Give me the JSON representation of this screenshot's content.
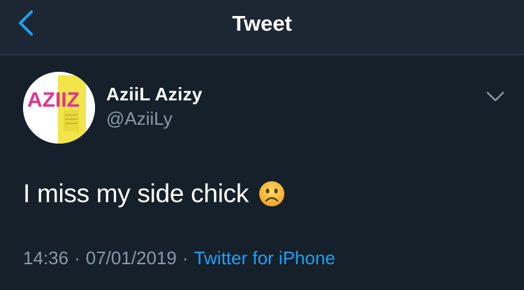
{
  "header": {
    "title": "Tweet"
  },
  "icons": {
    "back": "chevron-left-icon",
    "more": "chevron-down-icon",
    "emoji": "frowning-face-emoji"
  },
  "tweet": {
    "avatar_text": "AZIIZ",
    "display_name": "AziiL Azizy",
    "handle": "@AziiLy",
    "text": "I miss my side chick",
    "time": "14:36",
    "separator": "·",
    "date": "07/01/2019",
    "source": "Twitter for iPhone"
  },
  "colors": {
    "background": "#15202b",
    "header": "#1c2733",
    "accent": "#1da1f2",
    "secondary_text": "#8899a6"
  }
}
